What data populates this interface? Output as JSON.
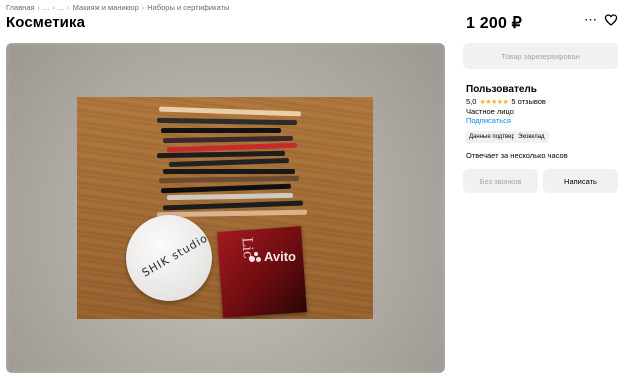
{
  "breadcrumb": {
    "items": [
      "Главная",
      "...",
      "...",
      "Макияж и маникюр",
      "Наборы и сертификаты"
    ],
    "separator": "›"
  },
  "listing": {
    "title": "Косметика",
    "price": "1 200 ₽"
  },
  "gallery": {
    "watermark": "Avito",
    "compact_brand": "SHIK studio",
    "palette_label": "Lic"
  },
  "actions": {
    "reserved_label": "Товар зарезервирован",
    "no_calls_label": "Без звонков",
    "write_label": "Написать",
    "more_icon": "more-icon",
    "favorite_icon": "heart-icon"
  },
  "seller": {
    "name": "Пользователь",
    "rating": "5,0",
    "stars": "★★★★★",
    "reviews": "5 отзывов",
    "type": "Частное лицо",
    "subscribe_label": "Подписаться",
    "badges": [
      "Данные подтверждены",
      "Эковклад"
    ],
    "response_time": "Отвечает за несколько часов"
  },
  "colors": {
    "accent_link": "#0a8cf0",
    "star": "#ffb021",
    "button_bg": "#f2f1f0",
    "muted_text": "#a5a5a5"
  }
}
